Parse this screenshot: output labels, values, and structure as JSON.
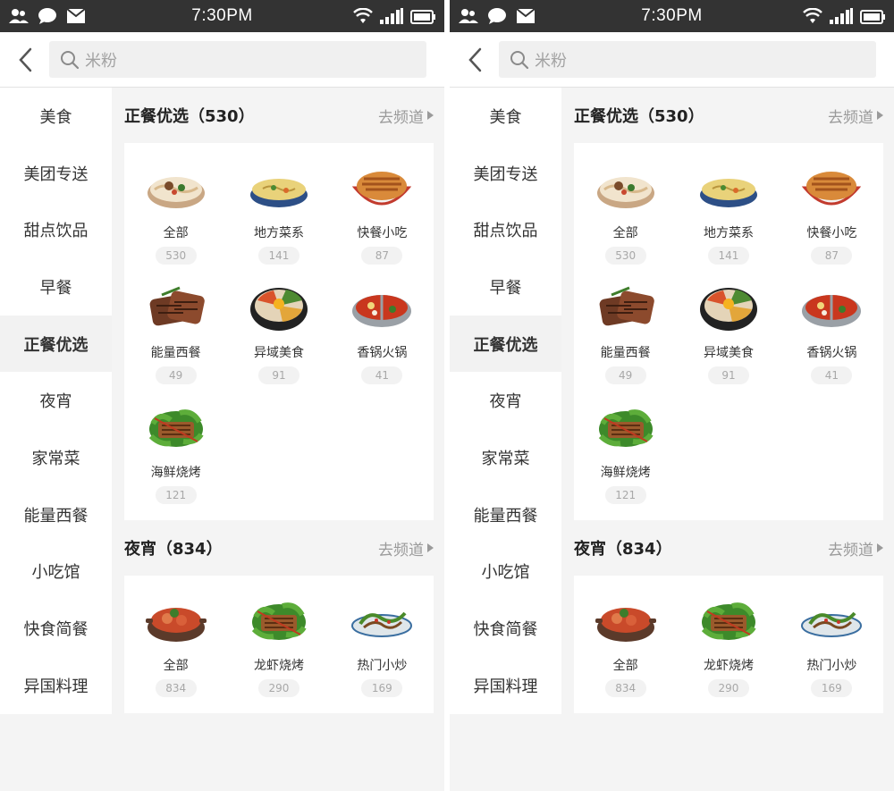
{
  "status": {
    "time": "7:30PM"
  },
  "search": {
    "placeholder": "米粉"
  },
  "sidebar": {
    "items": [
      "美食",
      "美团专送",
      "甜点饮品",
      "早餐",
      "正餐优选",
      "夜宵",
      "家常菜",
      "能量西餐",
      "小吃馆",
      "快食简餐",
      "异国料理"
    ],
    "active_index": 4
  },
  "section1": {
    "title": "正餐优选（530）",
    "link": "去频道",
    "items": [
      {
        "label": "全部",
        "count": "530",
        "icon": "noodle-bowl-icon"
      },
      {
        "label": "地方菜系",
        "count": "141",
        "icon": "soup-bowl-icon"
      },
      {
        "label": "快餐小吃",
        "count": "87",
        "icon": "rice-bowl-icon"
      },
      {
        "label": "能量西餐",
        "count": "49",
        "icon": "steak-icon"
      },
      {
        "label": "异域美食",
        "count": "91",
        "icon": "bibimbap-icon"
      },
      {
        "label": "香锅火锅",
        "count": "41",
        "icon": "hotpot-icon"
      },
      {
        "label": "海鲜烧烤",
        "count": "121",
        "icon": "skewers-icon"
      }
    ]
  },
  "section2": {
    "title": "夜宵（834）",
    "link": "去频道",
    "items": [
      {
        "label": "全部",
        "count": "834",
        "icon": "stew-pot-icon"
      },
      {
        "label": "龙虾烧烤",
        "count": "290",
        "icon": "skewers-icon"
      },
      {
        "label": "热门小炒",
        "count": "169",
        "icon": "stir-fry-icon"
      }
    ]
  }
}
